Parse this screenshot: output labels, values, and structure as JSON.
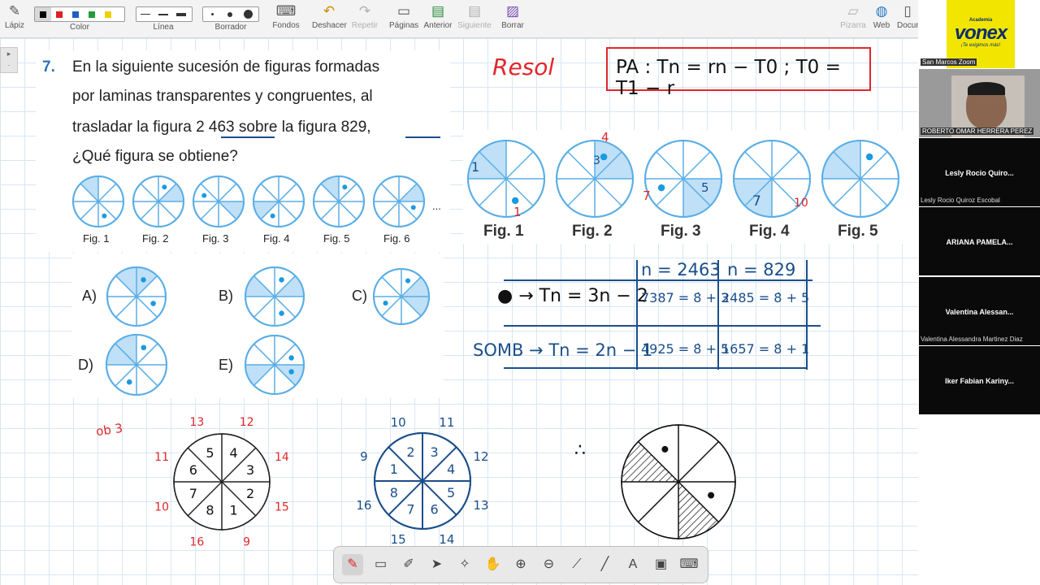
{
  "toolbar": {
    "lapiz": "Lápiz",
    "color": "Color",
    "linea": "Línea",
    "borrador": "Borrador",
    "fondos": "Fondos",
    "deshacer": "Deshacer",
    "repetir": "Repetir",
    "paginas": "Páginas",
    "anterior": "Anterior",
    "siguiente": "Siguiente",
    "borrar": "Borrar",
    "pizarra": "Pizarra",
    "web": "Web",
    "documentos": "Docum",
    "palette_colors": [
      "#000000",
      "#e02020",
      "#1f5fbf",
      "#1e9e3a",
      "#f0d000"
    ]
  },
  "problem": {
    "number": "7.",
    "lines": [
      "En la siguiente sucesión de figuras formadas",
      "por laminas transparentes y congruentes, al",
      "trasladar la figura 2 463 sobre la figura 829,",
      "¿Qué figura se obtiene?"
    ],
    "figures": [
      "Fig. 1",
      "Fig. 2",
      "Fig. 3",
      "Fig. 4",
      "Fig. 5",
      "Fig. 6"
    ],
    "ellipsis": "..."
  },
  "options": {
    "a": "A)",
    "b": "B)",
    "c": "C)",
    "d": "D)",
    "e": "E)"
  },
  "enlarged_figures": [
    "Fig. 1",
    "Fig. 2",
    "Fig. 3",
    "Fig. 4",
    "Fig. 5"
  ],
  "annotations": {
    "resol": "Resol",
    "pa_formula": "PA : Tn = rn − T0 ; T0 = T1 − r",
    "fig_marks": [
      "1",
      "1",
      "3",
      "4",
      "7",
      "5",
      "7",
      "10"
    ],
    "table_head_1": "n = 2463",
    "table_head_2": "n = 829",
    "row1_label": "● → Tn = 3n − 2",
    "row1_c1": "7387 = 8̇ + 3",
    "row1_c2": "2485 = 8̇ + 5",
    "row2_label": "SOMB → Tn = 2n − 1",
    "row2_c1": "4925 = 8̇ + 5",
    "row2_c2": "1657 = 8̇ + 1",
    "therefore": "∴",
    "side_note": "ob 3",
    "wheel1_inner": [
      "5",
      "4",
      "6",
      "3",
      "7",
      "2",
      "8",
      "1"
    ],
    "wheel1_outer": [
      "13",
      "12",
      "11",
      "14",
      "10",
      "15",
      "16",
      "9"
    ],
    "wheel2_inner": [
      "2",
      "3",
      "1",
      "4",
      "8",
      "5",
      "7",
      "6"
    ],
    "wheel2_outer": [
      "10",
      "11",
      "9",
      "12",
      "16",
      "13",
      "15",
      "14"
    ]
  },
  "participants": {
    "host_label": "San Marcos Zoom",
    "logo_small": "Academia",
    "logo_big": "vonex",
    "logo_tag": "¡Te exigimos más!",
    "speaker": "ROBERTO OMAR HERRERA PEREZ",
    "tiles": [
      {
        "name": "Lesly Rocio Quiro...",
        "sub": "Lesly Rocio Quiroz Escobal"
      },
      {
        "name": "ARIANA PAMELA...",
        "sub": ""
      },
      {
        "name": "Valentina Alessan...",
        "sub": "Valentina Alessandra Martinez Diaz"
      },
      {
        "name": "Iker Fabian Kariny...",
        "sub": ""
      }
    ]
  },
  "bottom_toolbar": {
    "icons": [
      "pen-icon",
      "eraser-icon",
      "highlighter-icon",
      "pointer-icon",
      "magic-pointer-icon",
      "hand-icon",
      "zoom-in-icon",
      "zoom-out-icon",
      "brush-icon",
      "line-icon",
      "text-icon",
      "screenshot-icon",
      "keyboard-icon"
    ]
  }
}
